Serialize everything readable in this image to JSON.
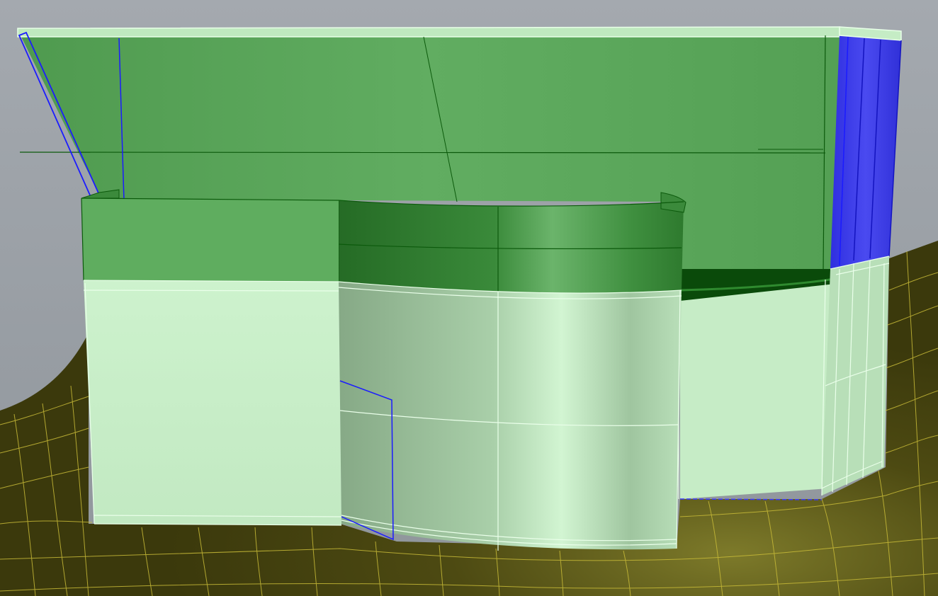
{
  "viewport": {
    "background_color": "#a2a7ad",
    "terrain_color": "#4a4810",
    "terrain_grid_color": "#c9bd3a",
    "wall_selected_color": "#5aa85a",
    "wall_dark_color": "#2d7a2d",
    "wall_light_color": "#c8efc8",
    "wall_mid_color": "#8fb28f",
    "outline_color": "#0c5a0c",
    "highlight_edge_color": "#e8ffe8",
    "selection_color": "#3b3be8",
    "selection_edge_color": "#1b1bff"
  },
  "scene": {
    "objects": [
      {
        "name": "terrain-surface",
        "state": "unselected"
      },
      {
        "name": "back-wall-panel",
        "state": "selected"
      },
      {
        "name": "front-left-wall",
        "state": "selected-top"
      },
      {
        "name": "curved-front-wall",
        "state": "selected-top"
      },
      {
        "name": "right-wall",
        "state": "unselected"
      },
      {
        "name": "right-column-strip",
        "state": "highlighted"
      },
      {
        "name": "door-opening",
        "state": "highlighted"
      }
    ]
  }
}
